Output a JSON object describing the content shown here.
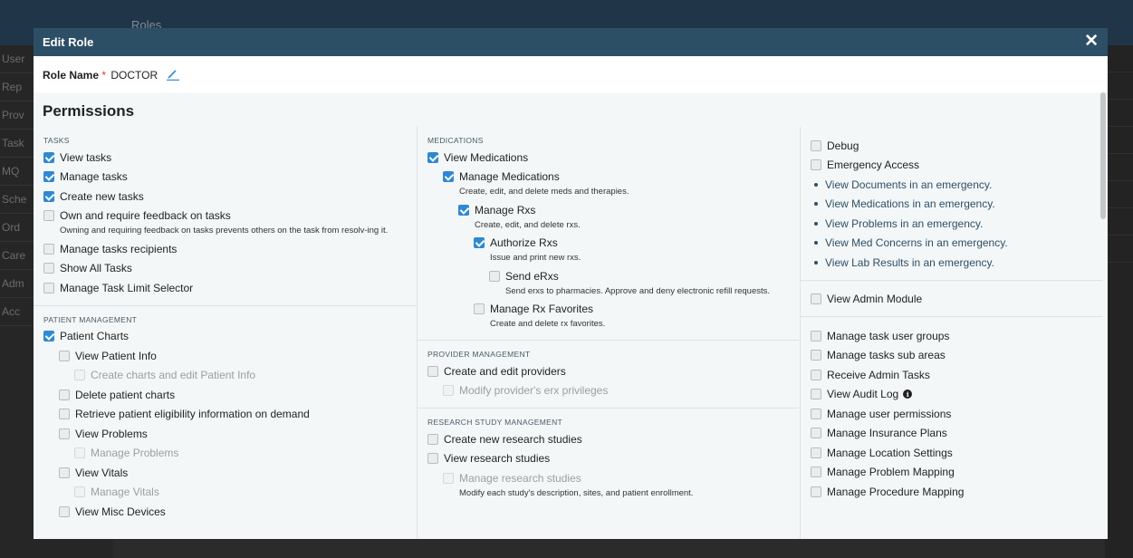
{
  "background": {
    "topbar_title": "Roles",
    "sidebar_items": [
      "User",
      "Rep",
      "Prov",
      "Task",
      "MQ",
      "Sche",
      "Ord",
      "Care",
      "Adm",
      "Acc"
    ]
  },
  "modal": {
    "title": "Edit Role",
    "close_label": "✕",
    "role_name_label": "Role Name",
    "required_mark": "*",
    "role_name_value": "DOCTOR",
    "permissions_heading": "Permissions"
  },
  "columns": [
    {
      "sections": [
        {
          "title": "TASKS",
          "items": [
            {
              "label": "View tasks",
              "checked": true,
              "indent": 0
            },
            {
              "label": "Manage tasks",
              "checked": true,
              "indent": 0
            },
            {
              "label": "Create new tasks",
              "checked": true,
              "indent": 0
            },
            {
              "label": "Own and require feedback on tasks",
              "checked": false,
              "indent": 0,
              "desc": "Owning and requiring feedback on tasks prevents others on the task from resolv-ing it."
            },
            {
              "label": "Manage tasks recipients",
              "checked": false,
              "indent": 0
            },
            {
              "label": "Show All Tasks",
              "checked": false,
              "indent": 0
            },
            {
              "label": "Manage Task Limit Selector",
              "checked": false,
              "indent": 0
            }
          ]
        },
        {
          "title": "PATIENT MANAGEMENT",
          "items": [
            {
              "label": "Patient Charts",
              "checked": true,
              "indent": 0
            },
            {
              "label": "View Patient Info",
              "checked": false,
              "indent": 1
            },
            {
              "label": "Create charts and edit Patient Info",
              "checked": false,
              "indent": 2,
              "disabled": true
            },
            {
              "label": "Delete patient charts",
              "checked": false,
              "indent": 1
            },
            {
              "label": "Retrieve patient eligibility information on demand",
              "checked": false,
              "indent": 1
            },
            {
              "label": "View Problems",
              "checked": false,
              "indent": 1
            },
            {
              "label": "Manage Problems",
              "checked": false,
              "indent": 2,
              "disabled": true
            },
            {
              "label": "View Vitals",
              "checked": false,
              "indent": 1
            },
            {
              "label": "Manage Vitals",
              "checked": false,
              "indent": 2,
              "disabled": true
            },
            {
              "label": "View Misc Devices",
              "checked": false,
              "indent": 1
            }
          ]
        }
      ]
    },
    {
      "sections": [
        {
          "title": "MEDICATIONS",
          "items": [
            {
              "label": "View Medications",
              "checked": true,
              "indent": 0
            },
            {
              "label": "Manage Medications",
              "checked": true,
              "indent": 1,
              "desc": "Create, edit, and delete meds and therapies."
            },
            {
              "label": "Manage Rxs",
              "checked": true,
              "indent": 2,
              "desc": "Create, edit, and delete rxs."
            },
            {
              "label": "Authorize Rxs",
              "checked": true,
              "indent": 3,
              "desc": "Issue and print new rxs."
            },
            {
              "label": "Send eRxs",
              "checked": false,
              "indent": 4,
              "desc": "Send erxs to pharmacies. Approve and deny electronic refill requests."
            },
            {
              "label": "Manage Rx Favorites",
              "checked": false,
              "indent": 3,
              "desc": "Create and delete rx favorites."
            }
          ]
        },
        {
          "title": "PROVIDER MANAGEMENT",
          "items": [
            {
              "label": "Create and edit providers",
              "checked": false,
              "indent": 0
            },
            {
              "label": "Modify provider's erx privileges",
              "checked": false,
              "indent": 1,
              "disabled": true
            }
          ]
        },
        {
          "title": "RESEARCH STUDY MANAGEMENT",
          "items": [
            {
              "label": "Create new research studies",
              "checked": false,
              "indent": 0
            },
            {
              "label": "View research studies",
              "checked": false,
              "indent": 0
            },
            {
              "label": "Manage research studies",
              "checked": false,
              "indent": 1,
              "disabled": true,
              "desc": "Modify each study's description, sites, and patient enrollment."
            }
          ]
        }
      ]
    },
    {
      "sections": [
        {
          "title": "",
          "items": [
            {
              "label": "Debug",
              "checked": false,
              "indent": 0
            },
            {
              "label": "Emergency Access",
              "checked": false,
              "indent": 0
            }
          ],
          "bullets": [
            "View Documents in an emergency.",
            "View Medications in an emergency.",
            "View Problems in an emergency.",
            "View Med Concerns in an emergency.",
            "View Lab Results in an emergency."
          ]
        },
        {
          "title": "",
          "items": [
            {
              "label": "View Admin Module",
              "checked": false,
              "indent": 0
            }
          ]
        },
        {
          "title": "",
          "items": [
            {
              "label": "Manage task user groups",
              "checked": false,
              "indent": 0
            },
            {
              "label": "Manage tasks sub areas",
              "checked": false,
              "indent": 0
            },
            {
              "label": "Receive Admin Tasks",
              "checked": false,
              "indent": 0
            },
            {
              "label": "View Audit Log",
              "checked": false,
              "indent": 0,
              "info": true
            },
            {
              "label": "Manage user permissions",
              "checked": false,
              "indent": 0
            },
            {
              "label": "Manage Insurance Plans",
              "checked": false,
              "indent": 0
            },
            {
              "label": "Manage Location Settings",
              "checked": false,
              "indent": 0
            },
            {
              "label": "Manage Problem Mapping",
              "checked": false,
              "indent": 0
            },
            {
              "label": "Manage Procedure Mapping",
              "checked": false,
              "indent": 0
            }
          ]
        }
      ]
    }
  ],
  "icons": {
    "edit": "pencil-icon",
    "close": "close-icon",
    "info": "info-icon"
  },
  "colors": {
    "header": "#2d4f66",
    "checkbox_checked": "#2f88d3",
    "required": "#e0342b",
    "link": "#2d4f66"
  }
}
